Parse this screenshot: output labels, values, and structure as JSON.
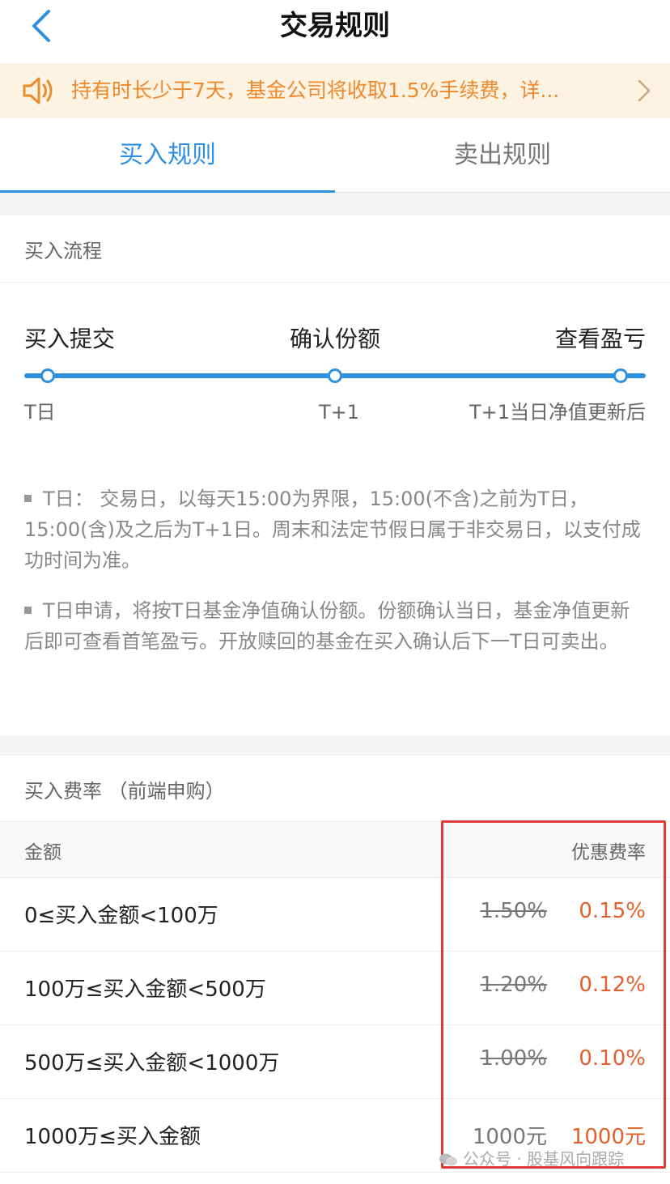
{
  "colors": {
    "accent": "#2f8fe0",
    "notice_bg": "#fdf3e3",
    "notice_text": "#ef8a2c",
    "discount": "#e2602c",
    "highlight_box": "#e03a3a"
  },
  "nav": {
    "title": "交易规则",
    "back_icon": "chevron-left-icon"
  },
  "notice": {
    "icon": "speaker-icon",
    "text": "持有时长少于7天，基金公司将收取1.5%手续费，详...",
    "arrow_icon": "chevron-right-icon"
  },
  "tabs": [
    {
      "label": "买入规则",
      "active": true
    },
    {
      "label": "卖出规则",
      "active": false
    }
  ],
  "flow": {
    "title": "买入流程",
    "steps": [
      {
        "label": "买入提交",
        "day": "T日"
      },
      {
        "label": "确认份额",
        "day": "T+1"
      },
      {
        "label": "查看盈亏",
        "day": "T+1当日净值更新后"
      }
    ],
    "notes": [
      "T日： 交易日，以每天15:00为界限，15:00(不含)之前为T日，15:00(含)及之后为T+1日。周末和法定节假日属于非交易日，以支付成功时间为准。",
      "T日申请，将按T日基金净值确认份额。份额确认当日，基金净值更新后即可查看首笔盈亏。开放赎回的基金在买入确认后下一T日可卖出。"
    ]
  },
  "fees": {
    "title": "买入费率 （前端申购）",
    "header": {
      "amount": "金额",
      "rate": "优惠费率"
    },
    "rows": [
      {
        "amount": "0≤买入金额<100万",
        "original": "1.50%",
        "discount": "0.15%"
      },
      {
        "amount": "100万≤买入金额<500万",
        "original": "1.20%",
        "discount": "0.12%"
      },
      {
        "amount": "500万≤买入金额<1000万",
        "original": "1.00%",
        "discount": "0.10%"
      },
      {
        "amount": "1000万≤买入金额",
        "original": "1000元",
        "discount": "1000元"
      }
    ]
  },
  "watermark": "公众号 · 股基风向跟踪"
}
